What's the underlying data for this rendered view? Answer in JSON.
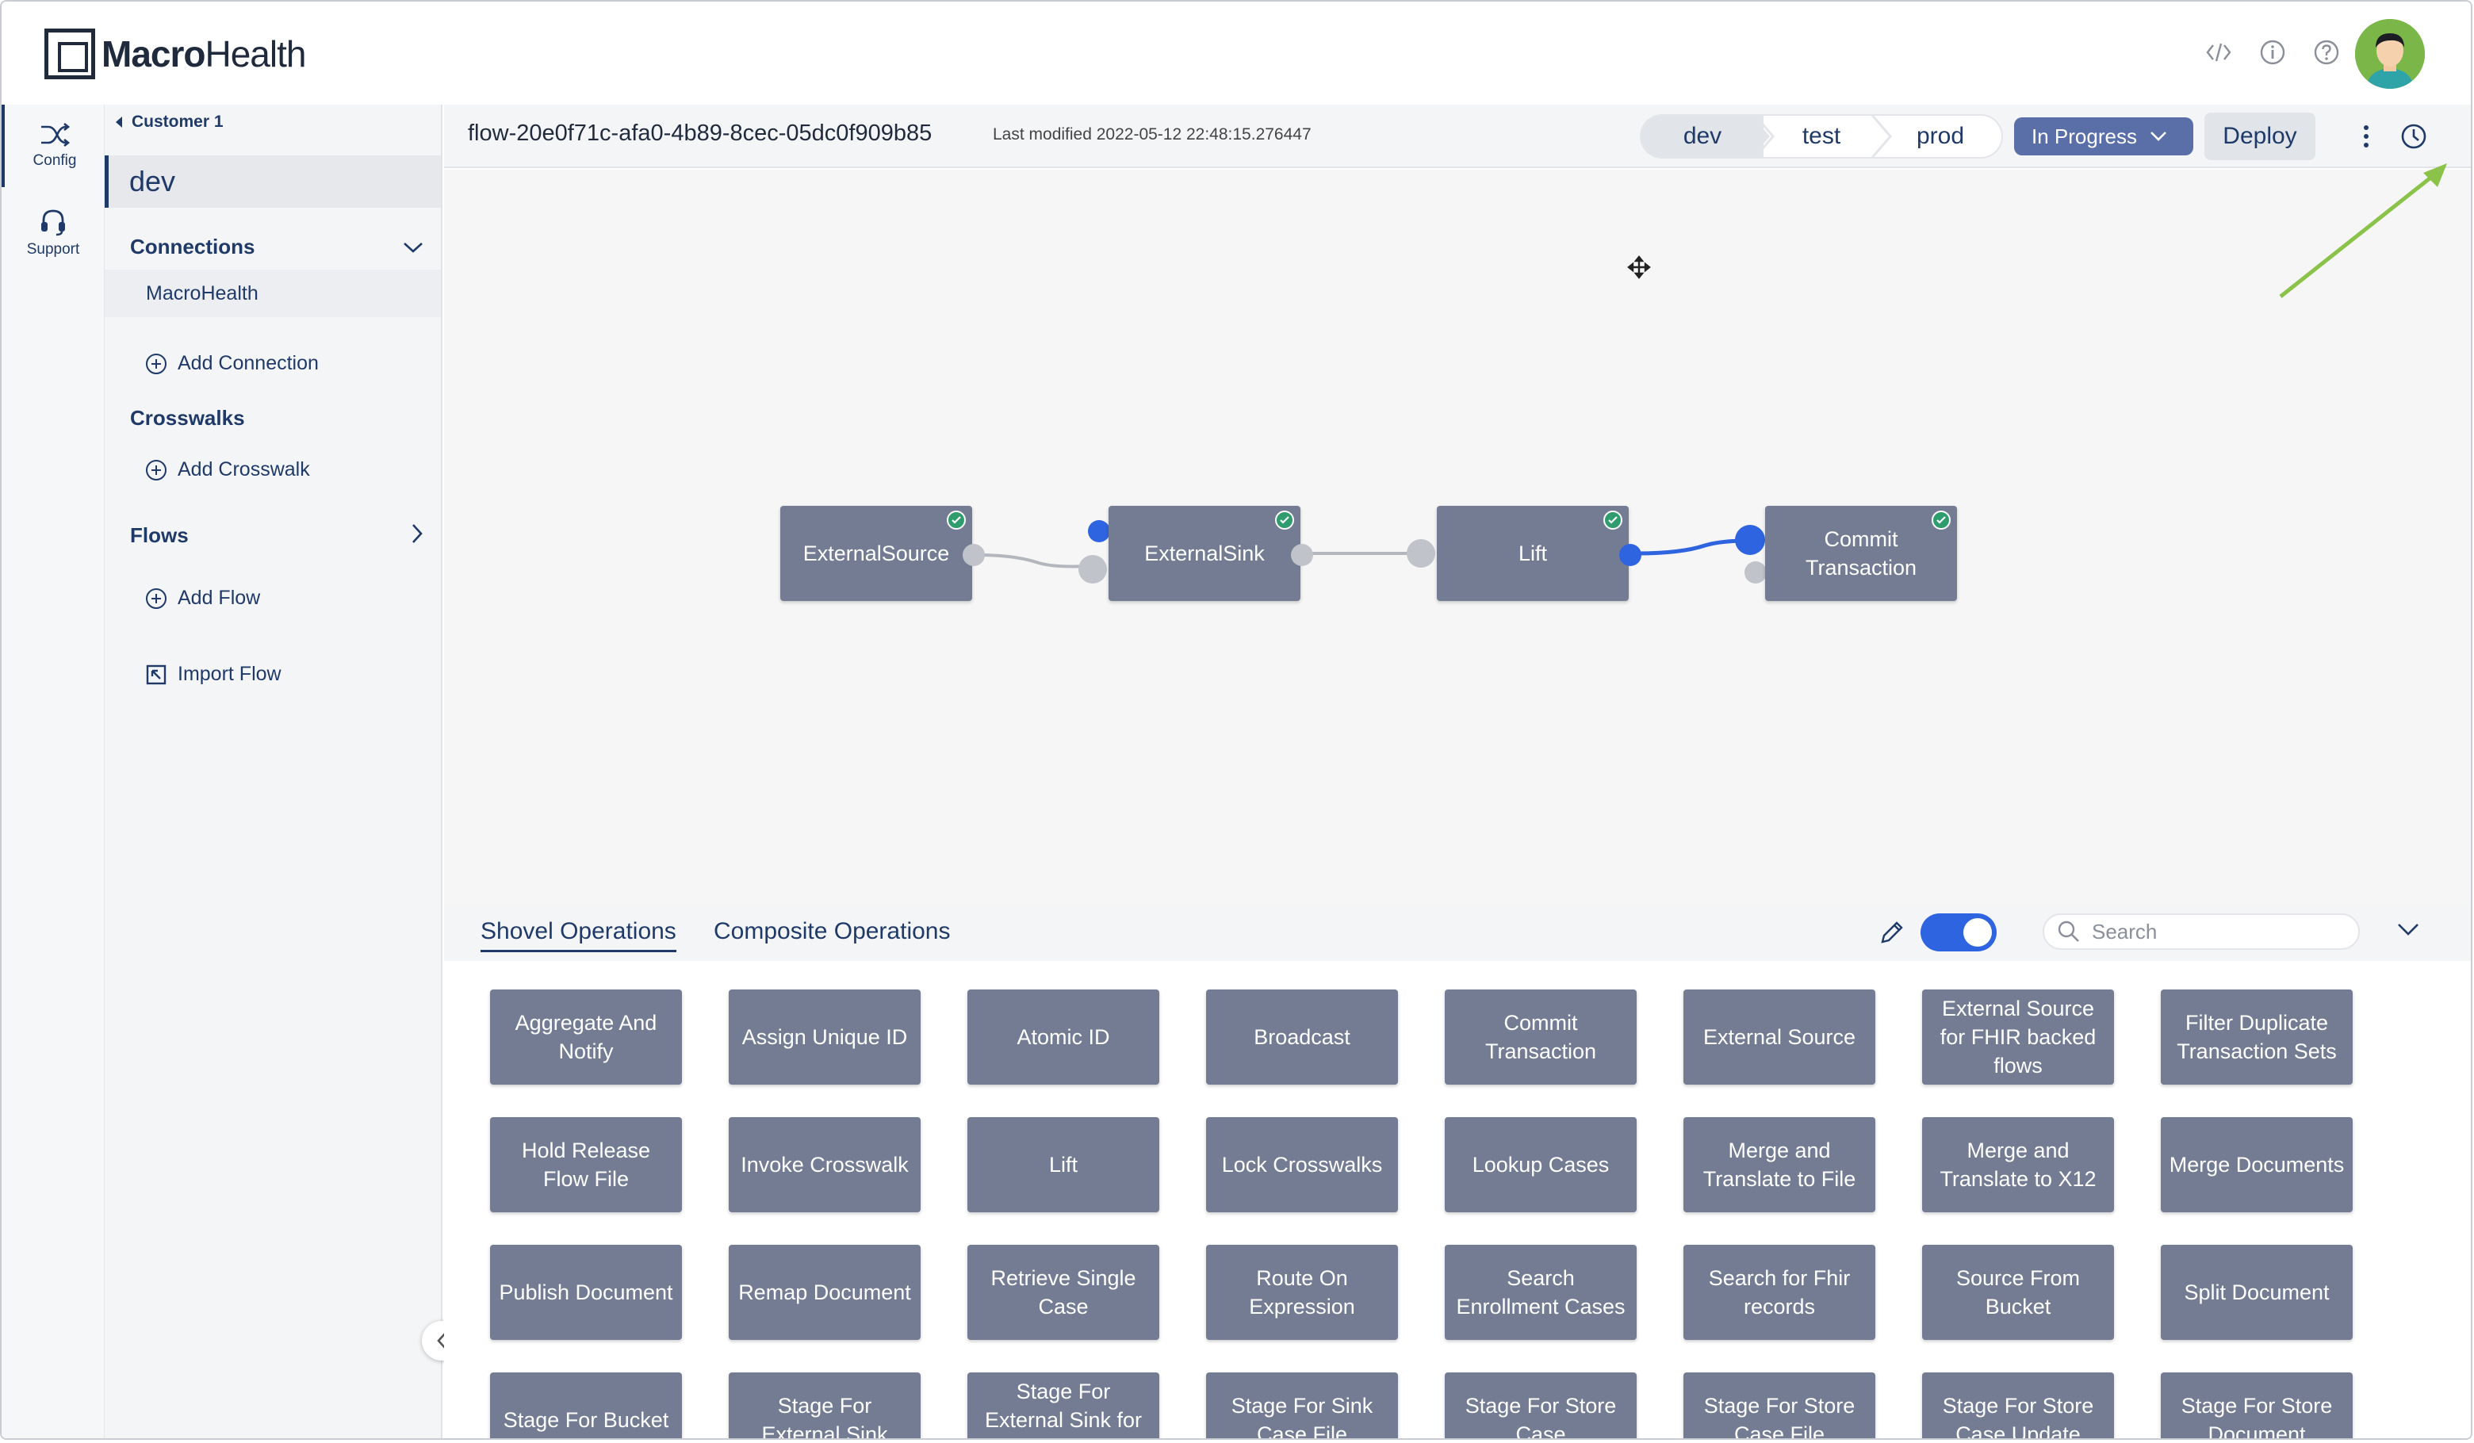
{
  "app": {
    "logo_bold": "Macro",
    "logo_light": "Health"
  },
  "header": {
    "icons": [
      "code-icon",
      "info-icon",
      "help-icon"
    ]
  },
  "rail": {
    "items": [
      {
        "label": "Config",
        "icon": "shuffle-icon"
      },
      {
        "label": "Support",
        "icon": "headset-icon"
      }
    ]
  },
  "sidebar": {
    "breadcrumb": "Customer 1",
    "environment": "dev",
    "connections_label": "Connections",
    "connection_item": "MacroHealth",
    "add_connection": "Add Connection",
    "crosswalks_label": "Crosswalks",
    "add_crosswalk": "Add Crosswalk",
    "flows_label": "Flows",
    "add_flow": "Add Flow",
    "import_flow": "Import Flow"
  },
  "toolbar": {
    "flow_id": "flow-20e0f71c-afa0-4b89-8cec-05dc0f909b85",
    "last_modified": "Last modified 2022-05-12 22:48:15.276447",
    "stages": [
      "dev",
      "test",
      "prod"
    ],
    "status": "In Progress",
    "deploy_label": "Deploy"
  },
  "canvas": {
    "nodes": [
      {
        "label": "ExternalSource",
        "status": "ok"
      },
      {
        "label": "ExternalSink",
        "status": "ok"
      },
      {
        "label": "Lift",
        "status": "ok"
      },
      {
        "label": "Commit Transaction",
        "status": "ok"
      }
    ]
  },
  "operations": {
    "tabs": [
      "Shovel Operations",
      "Composite Operations"
    ],
    "search_placeholder": "Search",
    "toggle_on": true,
    "items": [
      "Aggregate And Notify",
      "Assign Unique ID",
      "Atomic ID",
      "Broadcast",
      "Commit Transaction",
      "External Source",
      "External Source for FHIR backed flows",
      "Filter Duplicate Transaction Sets",
      "Hold Release Flow File",
      "Invoke Crosswalk",
      "Lift",
      "Lock Crosswalks",
      "Lookup Cases",
      "Merge and Translate to File",
      "Merge and Translate to X12",
      "Merge Documents",
      "Publish Document",
      "Remap Document",
      "Retrieve Single Case",
      "Route On Expression",
      "Search Enrollment Cases",
      "Search for Fhir records",
      "Source From Bucket",
      "Split Document",
      "Stage For Bucket",
      "Stage For External Sink",
      "Stage For External Sink for FHIR",
      "Stage For Sink Case File",
      "Stage For Store Case",
      "Stage For Store Case File",
      "Stage For Store Case Update",
      "Stage For Store Document"
    ]
  },
  "colors": {
    "primary": "#1f3a68",
    "node": "#737c92",
    "accent_blue": "#2f64e0",
    "status_ok": "#2f9c6e",
    "annotation_arrow": "#8bc34a"
  }
}
